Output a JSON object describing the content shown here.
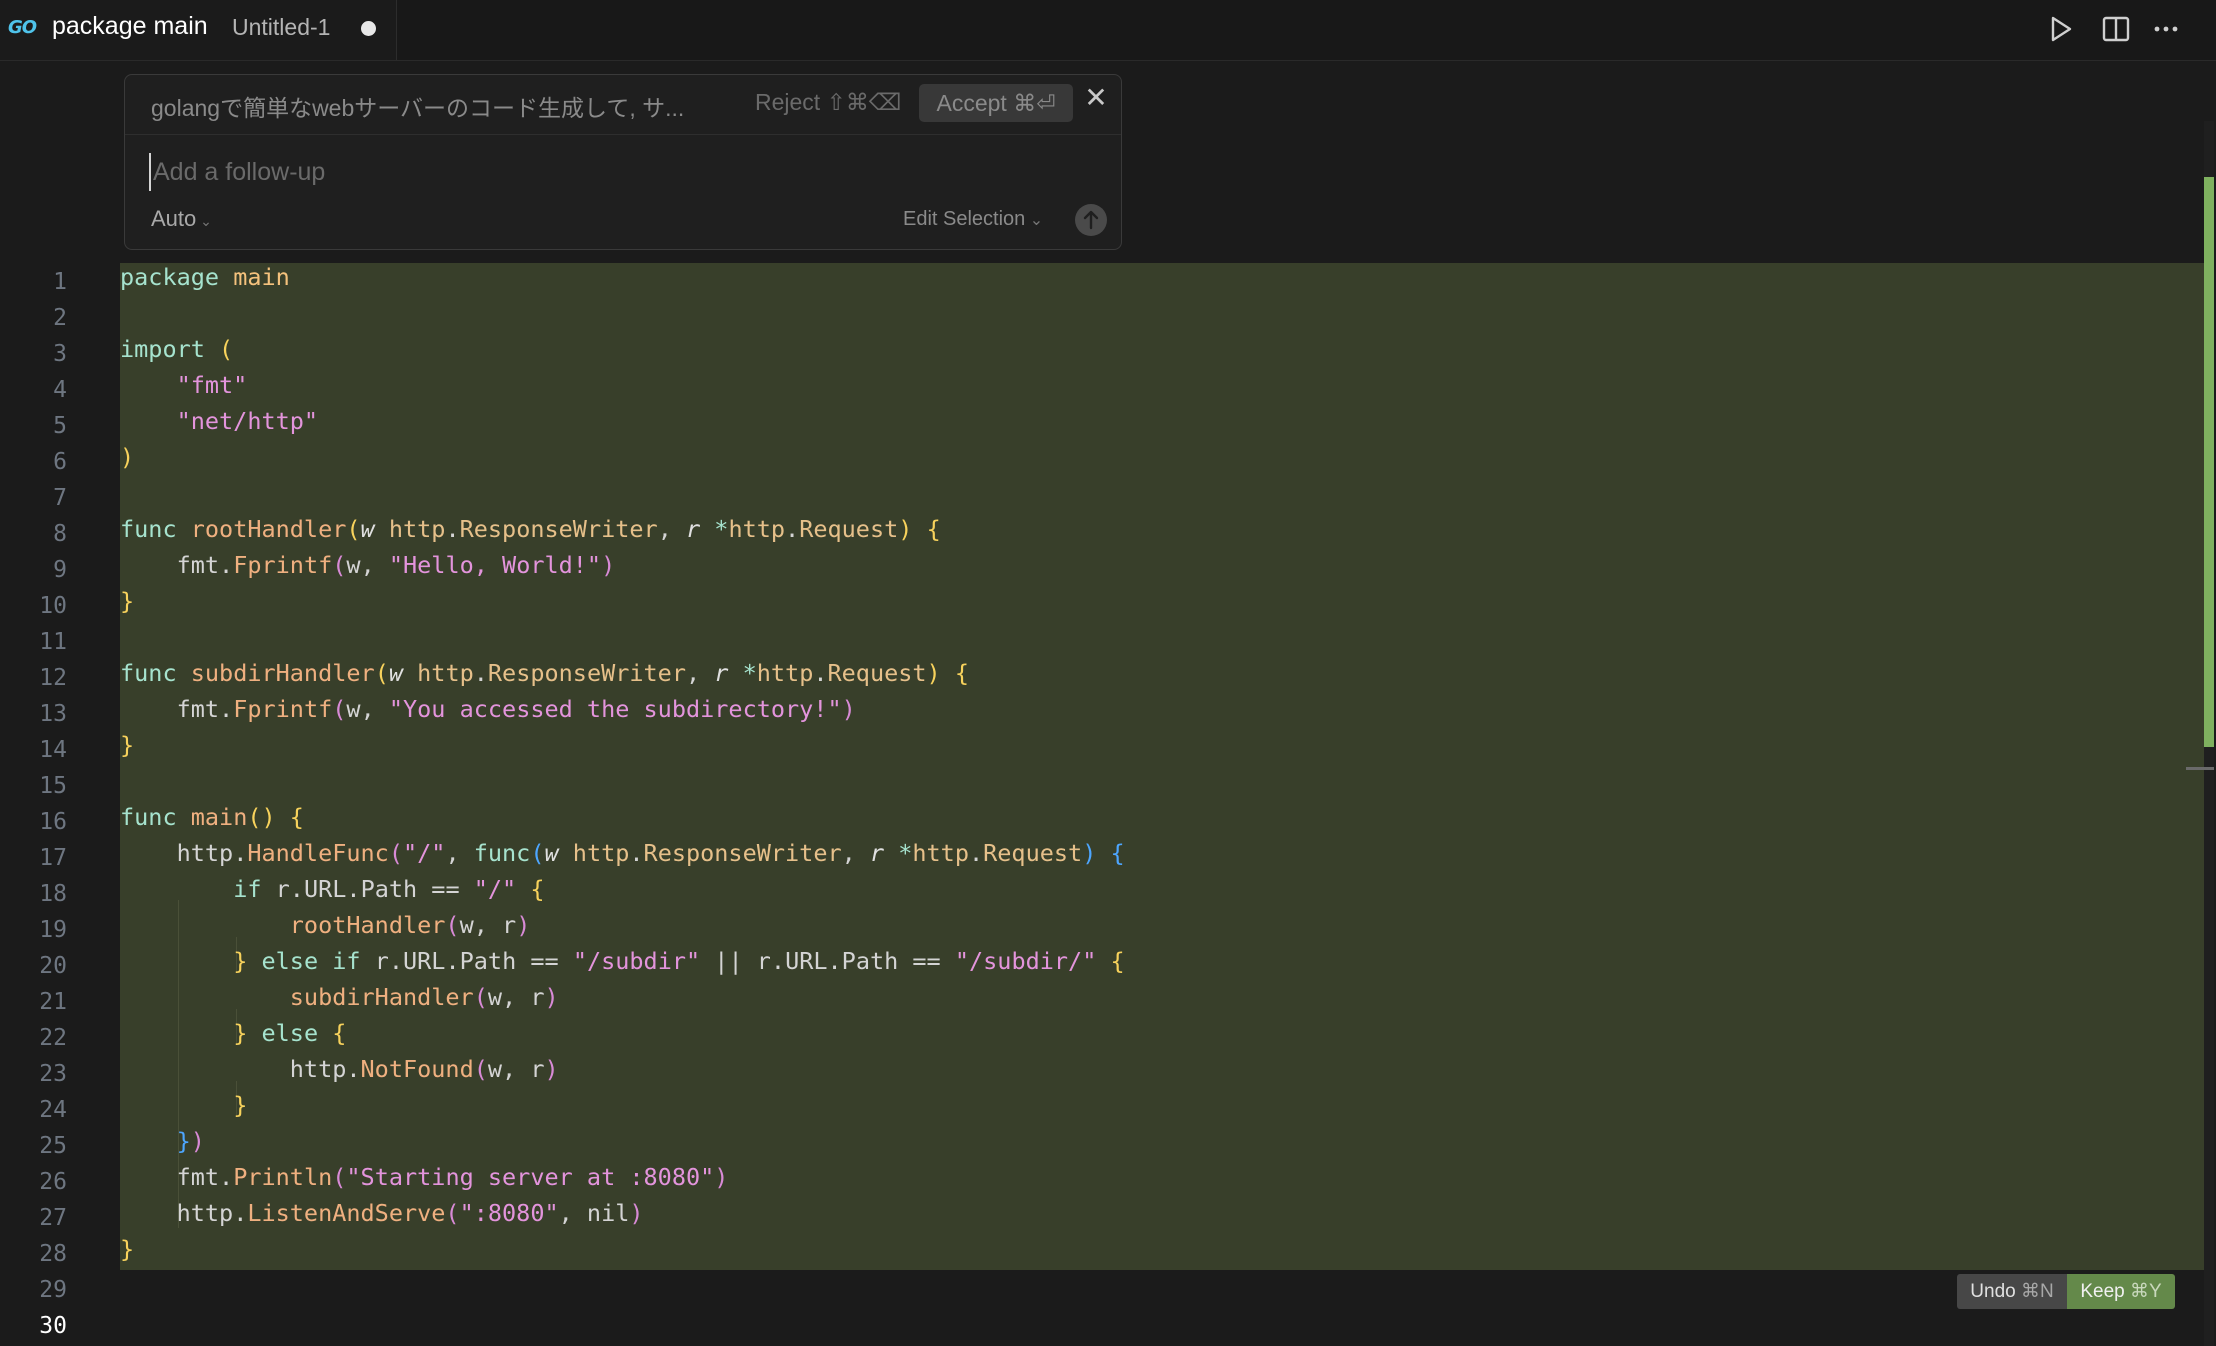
{
  "tab": {
    "logo": "GO",
    "title": "package main",
    "subtitle": "Untitled-1"
  },
  "toolbar": {
    "run_icon": "play-icon",
    "split_icon": "split-editor-icon",
    "more_icon": "more-icon"
  },
  "inline_chat": {
    "prompt": "golangで簡単なwebサーバーのコード生成して, サ...",
    "reject_label": "Reject ⇧⌘⌫",
    "accept_label": "Accept ⌘⏎",
    "close_label": "✕",
    "followup_placeholder": "Add a follow-up",
    "model_label": "Auto",
    "mode_label": "Edit Selection"
  },
  "editor": {
    "line_numbers": [
      "1",
      "2",
      "3",
      "4",
      "5",
      "6",
      "7",
      "8",
      "9",
      "10",
      "11",
      "12",
      "13",
      "14",
      "15",
      "16",
      "17",
      "18",
      "19",
      "20",
      "21",
      "22",
      "23",
      "24",
      "25",
      "26",
      "27",
      "28",
      "29",
      "30"
    ],
    "active_line": "30"
  },
  "diff_actions": {
    "undo_label": "Undo",
    "undo_shortcut": "⌘N",
    "keep_label": "Keep",
    "keep_shortcut": "⌘Y"
  },
  "colors": {
    "diff_added_bg": "#383f2a",
    "keep_button": "#64894a",
    "scroll_thumb": "#7fb15f"
  }
}
